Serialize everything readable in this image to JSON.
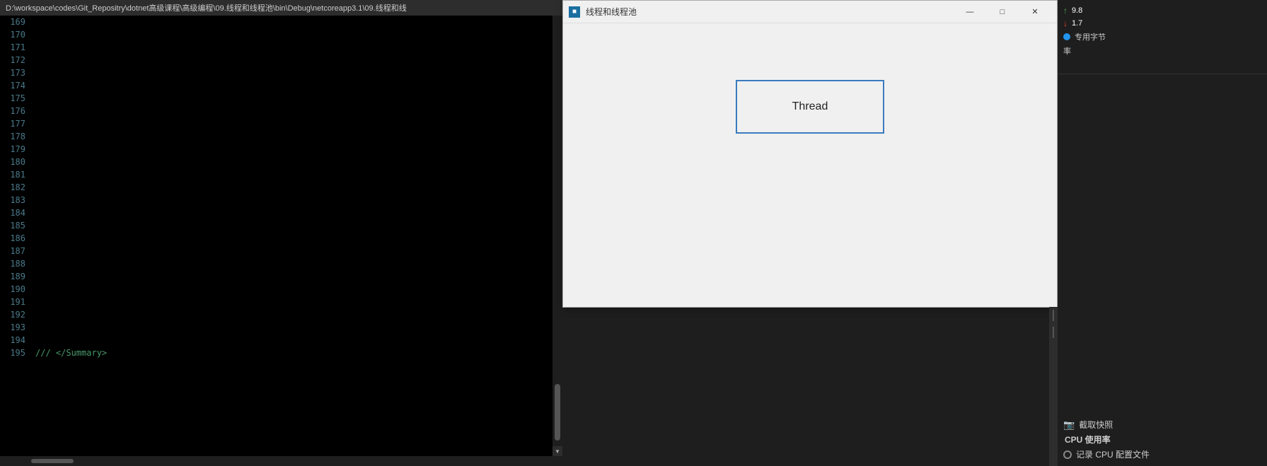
{
  "editor": {
    "titlebar_text": "D:\\workspace\\codes\\Git_Repositry\\dotnet高级课程\\高级编程\\09.线程和线程池\\bin\\Debug\\netcoreapp3.1\\09.线程和线",
    "lines": [
      {
        "num": "169",
        "code": ""
      },
      {
        "num": "170",
        "code": ""
      },
      {
        "num": "171",
        "code": ""
      },
      {
        "num": "172",
        "code": ""
      },
      {
        "num": "173",
        "code": ""
      },
      {
        "num": "174",
        "code": ""
      },
      {
        "num": "175",
        "code": ""
      },
      {
        "num": "176",
        "code": ""
      },
      {
        "num": "177",
        "code": ""
      },
      {
        "num": "178",
        "code": ""
      },
      {
        "num": "179",
        "code": ""
      },
      {
        "num": "180",
        "code": ""
      },
      {
        "num": "181",
        "code": ""
      },
      {
        "num": "182",
        "code": ""
      },
      {
        "num": "183",
        "code": ""
      },
      {
        "num": "184",
        "code": ""
      },
      {
        "num": "185",
        "code": ""
      },
      {
        "num": "186",
        "code": ""
      },
      {
        "num": "187",
        "code": ""
      },
      {
        "num": "188",
        "code": ""
      },
      {
        "num": "189",
        "code": ""
      },
      {
        "num": "190",
        "code": ""
      },
      {
        "num": "191",
        "code": ""
      },
      {
        "num": "192",
        "code": ""
      },
      {
        "num": "193",
        "code": ""
      },
      {
        "num": "194",
        "code": ""
      },
      {
        "num": "195",
        "code": "    /// </Summary>"
      }
    ]
  },
  "wpf_window": {
    "title": "线程和线程池",
    "title_icon": "■",
    "thread_button_label": "Thread",
    "minimize_label": "—",
    "maximize_label": "□",
    "close_label": "✕"
  },
  "right_panel": {
    "network_up_value": "9.8",
    "network_down_value": "1.7",
    "exclusive_label": "专用字节",
    "rate_label": "率",
    "screenshot_label": "截取快照",
    "cpu_usage_label": "CPU 使用率",
    "cpu_record_label": "记录 CPU 配置文件"
  }
}
